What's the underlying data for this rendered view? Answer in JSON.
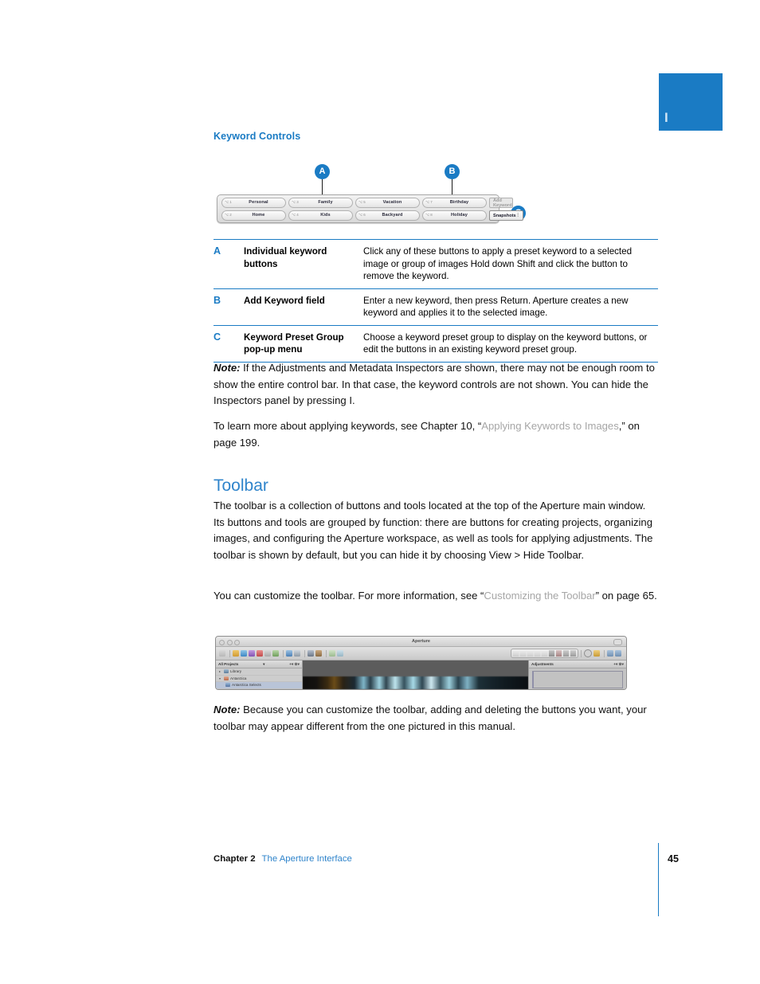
{
  "chapter_tab": {
    "letter": "I",
    "color": "#1a7bc4"
  },
  "section": {
    "subheading": "Keyword Controls",
    "heading": "Toolbar"
  },
  "figure": {
    "callouts": [
      "A",
      "B",
      "C"
    ],
    "keyword_bar": {
      "row1": [
        {
          "shortcut": "⌥ 1",
          "label": "Personal"
        },
        {
          "shortcut": "⌥ 3",
          "label": "Family"
        },
        {
          "shortcut": "⌥ 5",
          "label": "Vacation"
        },
        {
          "shortcut": "⌥ 7",
          "label": "Birthday"
        }
      ],
      "row2": [
        {
          "shortcut": "⌥ 2",
          "label": "Home"
        },
        {
          "shortcut": "⌥ 4",
          "label": "Kids"
        },
        {
          "shortcut": "⌥ 6",
          "label": "Backyard"
        },
        {
          "shortcut": "⌥ 8",
          "label": "Holiday"
        }
      ],
      "add_keyword_placeholder": "Add Keyword",
      "preset_group_value": "Snapshots"
    }
  },
  "legend_table": {
    "rows": [
      {
        "key": "A",
        "term": "Individual keyword buttons",
        "desc": "Click any of these buttons to apply a preset keyword to a selected image or group of images Hold down Shift and click the button to remove the keyword."
      },
      {
        "key": "B",
        "term": "Add Keyword field",
        "desc": "Enter a new keyword, then press Return. Aperture creates a new keyword and applies it to the selected image."
      },
      {
        "key": "C",
        "term": "Keyword Preset Group pop-up menu",
        "desc": "Choose a keyword preset group to display on the keyword buttons, or edit the buttons in an existing keyword preset group."
      }
    ]
  },
  "notes": {
    "note_label": "Note:",
    "note1_text": "If the Adjustments and Metadata Inspectors are shown, there may not be enough room to show the entire control bar. In that case, the keyword controls are not shown. You can hide the Inspectors panel by pressing I.",
    "note2_text": "Because you can customize the toolbar, adding and deleting the buttons you want, your toolbar may appear different from the one pictured in this manual."
  },
  "crossref1": {
    "lead": "To learn more about applying keywords, see Chapter 10, “",
    "link": "Applying Keywords to Images",
    "tail": ",” on page 199."
  },
  "toolbar_body": "The toolbar is a collection of buttons and tools located at the top of the Aperture main window. Its buttons and tools are grouped by function: there are buttons for creating projects, organizing images, and configuring the Aperture workspace, as well as tools for applying adjustments. The toolbar is shown by default, but you can hide it by choosing View > Hide Toolbar.",
  "crossref2": {
    "lead": "You can customize the toolbar. For more information, see “",
    "link": "Customizing the Toolbar",
    "tail": "” on page 65."
  },
  "aperture_window": {
    "title": "Aperture",
    "left_panel": {
      "header": "All Projects",
      "header_caret": "▾",
      "items": [
        {
          "disclosure": "▸",
          "label": "Library"
        },
        {
          "disclosure": "▾",
          "label": "Antarctica"
        },
        {
          "disclosure": "",
          "label": "Antarctica Selects"
        }
      ]
    },
    "right_panel": {
      "header": "Adjustments"
    }
  },
  "footer": {
    "chapter": "Chapter 2",
    "chapter_name": "The Aperture Interface",
    "page_number": "45"
  }
}
